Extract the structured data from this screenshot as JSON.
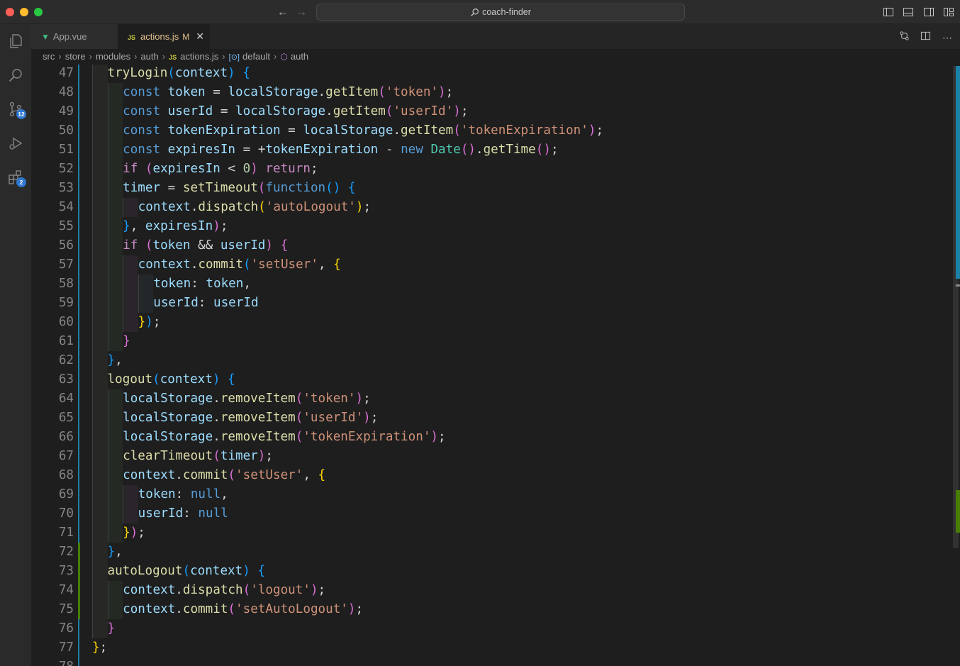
{
  "window": {
    "title": "coach-finder"
  },
  "activity": {
    "items": [
      {
        "name": "explorer-icon"
      },
      {
        "name": "search-icon"
      },
      {
        "name": "source-control-icon",
        "badge": "12"
      },
      {
        "name": "run-debug-icon"
      },
      {
        "name": "extensions-icon",
        "badge": "2"
      }
    ]
  },
  "tabs": [
    {
      "label": "App.vue",
      "icon": "vue-icon",
      "active": false
    },
    {
      "label": "actions.js",
      "icon": "js-icon",
      "active": true,
      "modified": "M"
    }
  ],
  "breadcrumb": [
    "src",
    "store",
    "modules",
    "auth",
    "actions.js",
    "default",
    "auth"
  ],
  "editor": {
    "language": "javascript",
    "lines": [
      {
        "n": "47",
        "indent": 1,
        "tokens": [
          [
            "fn",
            "tryLogin"
          ],
          [
            "p3",
            "("
          ],
          [
            "var",
            "context"
          ],
          [
            "p3",
            ")"
          ],
          [
            "op",
            " "
          ],
          [
            "p3",
            "{"
          ]
        ]
      },
      {
        "n": "48",
        "indent": 2,
        "tokens": [
          [
            "kw",
            "const"
          ],
          [
            "op",
            " "
          ],
          [
            "var",
            "token"
          ],
          [
            "op",
            " = "
          ],
          [
            "var",
            "localStorage"
          ],
          [
            "op",
            "."
          ],
          [
            "fn",
            "getItem"
          ],
          [
            "p2",
            "("
          ],
          [
            "str",
            "'token'"
          ],
          [
            "p2",
            ")"
          ],
          [
            "op",
            ";"
          ]
        ]
      },
      {
        "n": "49",
        "indent": 2,
        "tokens": [
          [
            "kw",
            "const"
          ],
          [
            "op",
            " "
          ],
          [
            "var",
            "userId"
          ],
          [
            "op",
            " = "
          ],
          [
            "var",
            "localStorage"
          ],
          [
            "op",
            "."
          ],
          [
            "fn",
            "getItem"
          ],
          [
            "p2",
            "("
          ],
          [
            "str",
            "'userId'"
          ],
          [
            "p2",
            ")"
          ],
          [
            "op",
            ";"
          ]
        ]
      },
      {
        "n": "50",
        "indent": 2,
        "tokens": [
          [
            "kw",
            "const"
          ],
          [
            "op",
            " "
          ],
          [
            "var",
            "tokenExpiration"
          ],
          [
            "op",
            " = "
          ],
          [
            "var",
            "localStorage"
          ],
          [
            "op",
            "."
          ],
          [
            "fn",
            "getItem"
          ],
          [
            "p2",
            "("
          ],
          [
            "str",
            "'tokenExpiration'"
          ],
          [
            "p2",
            ")"
          ],
          [
            "op",
            ";"
          ]
        ]
      },
      {
        "n": "51",
        "indent": 2,
        "tokens": [
          [
            "kw",
            "const"
          ],
          [
            "op",
            " "
          ],
          [
            "var",
            "expiresIn"
          ],
          [
            "op",
            " = +"
          ],
          [
            "var",
            "tokenExpiration"
          ],
          [
            "op",
            " - "
          ],
          [
            "kw",
            "new"
          ],
          [
            "op",
            " "
          ],
          [
            "cls",
            "Date"
          ],
          [
            "p2",
            "()"
          ],
          [
            "op",
            "."
          ],
          [
            "fn",
            "getTime"
          ],
          [
            "p2",
            "()"
          ],
          [
            "op",
            ";"
          ]
        ]
      },
      {
        "n": "52",
        "indent": 2,
        "tokens": [
          [
            "ctl",
            "if"
          ],
          [
            "op",
            " "
          ],
          [
            "p2",
            "("
          ],
          [
            "var",
            "expiresIn"
          ],
          [
            "op",
            " < "
          ],
          [
            "num",
            "0"
          ],
          [
            "p2",
            ")"
          ],
          [
            "op",
            " "
          ],
          [
            "ctl",
            "return"
          ],
          [
            "op",
            ";"
          ]
        ]
      },
      {
        "n": "53",
        "indent": 2,
        "tokens": [
          [
            "var",
            "timer"
          ],
          [
            "op",
            " = "
          ],
          [
            "fn",
            "setTimeout"
          ],
          [
            "p2",
            "("
          ],
          [
            "kw",
            "function"
          ],
          [
            "p3",
            "()"
          ],
          [
            "op",
            " "
          ],
          [
            "p3",
            "{"
          ]
        ]
      },
      {
        "n": "54",
        "indent": 3,
        "tokens": [
          [
            "var",
            "context"
          ],
          [
            "op",
            "."
          ],
          [
            "fn",
            "dispatch"
          ],
          [
            "p1",
            "("
          ],
          [
            "str",
            "'autoLogout'"
          ],
          [
            "p1",
            ")"
          ],
          [
            "op",
            ";"
          ]
        ]
      },
      {
        "n": "55",
        "indent": 2,
        "tokens": [
          [
            "p3",
            "}"
          ],
          [
            "op",
            ", "
          ],
          [
            "var",
            "expiresIn"
          ],
          [
            "p2",
            ")"
          ],
          [
            "op",
            ";"
          ]
        ]
      },
      {
        "n": "56",
        "indent": 2,
        "tokens": [
          [
            "ctl",
            "if"
          ],
          [
            "op",
            " "
          ],
          [
            "p2",
            "("
          ],
          [
            "var",
            "token"
          ],
          [
            "op",
            " && "
          ],
          [
            "var",
            "userId"
          ],
          [
            "p2",
            ")"
          ],
          [
            "op",
            " "
          ],
          [
            "p2",
            "{"
          ]
        ]
      },
      {
        "n": "57",
        "indent": 3,
        "tokens": [
          [
            "var",
            "context"
          ],
          [
            "op",
            "."
          ],
          [
            "fn",
            "commit"
          ],
          [
            "p3",
            "("
          ],
          [
            "str",
            "'setUser'"
          ],
          [
            "op",
            ", "
          ],
          [
            "p1",
            "{"
          ]
        ]
      },
      {
        "n": "58",
        "indent": 4,
        "tokens": [
          [
            "var",
            "token"
          ],
          [
            "op",
            ": "
          ],
          [
            "var",
            "token"
          ],
          [
            "op",
            ","
          ]
        ]
      },
      {
        "n": "59",
        "indent": 4,
        "tokens": [
          [
            "var",
            "userId"
          ],
          [
            "op",
            ": "
          ],
          [
            "var",
            "userId"
          ]
        ]
      },
      {
        "n": "60",
        "indent": 3,
        "tokens": [
          [
            "p1",
            "}"
          ],
          [
            "p3",
            ")"
          ],
          [
            "op",
            ";"
          ]
        ]
      },
      {
        "n": "61",
        "indent": 2,
        "tokens": [
          [
            "p2",
            "}"
          ]
        ]
      },
      {
        "n": "62",
        "indent": 1,
        "tokens": [
          [
            "p3",
            "}"
          ],
          [
            "op",
            ","
          ]
        ]
      },
      {
        "n": "63",
        "indent": 1,
        "tokens": [
          [
            "fn",
            "logout"
          ],
          [
            "p3",
            "("
          ],
          [
            "var",
            "context"
          ],
          [
            "p3",
            ")"
          ],
          [
            "op",
            " "
          ],
          [
            "p3",
            "{"
          ]
        ]
      },
      {
        "n": "64",
        "indent": 2,
        "tokens": [
          [
            "var",
            "localStorage"
          ],
          [
            "op",
            "."
          ],
          [
            "fn",
            "removeItem"
          ],
          [
            "p2",
            "("
          ],
          [
            "str",
            "'token'"
          ],
          [
            "p2",
            ")"
          ],
          [
            "op",
            ";"
          ]
        ]
      },
      {
        "n": "65",
        "indent": 2,
        "tokens": [
          [
            "var",
            "localStorage"
          ],
          [
            "op",
            "."
          ],
          [
            "fn",
            "removeItem"
          ],
          [
            "p2",
            "("
          ],
          [
            "str",
            "'userId'"
          ],
          [
            "p2",
            ")"
          ],
          [
            "op",
            ";"
          ]
        ]
      },
      {
        "n": "66",
        "indent": 2,
        "tokens": [
          [
            "var",
            "localStorage"
          ],
          [
            "op",
            "."
          ],
          [
            "fn",
            "removeItem"
          ],
          [
            "p2",
            "("
          ],
          [
            "str",
            "'tokenExpiration'"
          ],
          [
            "p2",
            ")"
          ],
          [
            "op",
            ";"
          ]
        ]
      },
      {
        "n": "67",
        "indent": 2,
        "tokens": [
          [
            "fn",
            "clearTimeout"
          ],
          [
            "p2",
            "("
          ],
          [
            "var",
            "timer"
          ],
          [
            "p2",
            ")"
          ],
          [
            "op",
            ";"
          ]
        ]
      },
      {
        "n": "68",
        "indent": 2,
        "tokens": [
          [
            "var",
            "context"
          ],
          [
            "op",
            "."
          ],
          [
            "fn",
            "commit"
          ],
          [
            "p2",
            "("
          ],
          [
            "str",
            "'setUser'"
          ],
          [
            "op",
            ", "
          ],
          [
            "p1",
            "{"
          ]
        ]
      },
      {
        "n": "69",
        "indent": 3,
        "tokens": [
          [
            "var",
            "token"
          ],
          [
            "op",
            ": "
          ],
          [
            "kw",
            "null"
          ],
          [
            "op",
            ","
          ]
        ]
      },
      {
        "n": "70",
        "indent": 3,
        "tokens": [
          [
            "var",
            "userId"
          ],
          [
            "op",
            ": "
          ],
          [
            "kw",
            "null"
          ]
        ]
      },
      {
        "n": "71",
        "indent": 2,
        "tokens": [
          [
            "p1",
            "}"
          ],
          [
            "p2",
            ")"
          ],
          [
            "op",
            ";"
          ]
        ]
      },
      {
        "n": "72",
        "indent": 1,
        "tokens": [
          [
            "p3",
            "}"
          ],
          [
            "op",
            ","
          ]
        ]
      },
      {
        "n": "73",
        "indent": 1,
        "tokens": [
          [
            "fn",
            "autoLogout"
          ],
          [
            "p3",
            "("
          ],
          [
            "var",
            "context"
          ],
          [
            "p3",
            ")"
          ],
          [
            "op",
            " "
          ],
          [
            "p3",
            "{"
          ]
        ]
      },
      {
        "n": "74",
        "indent": 2,
        "tokens": [
          [
            "var",
            "context"
          ],
          [
            "op",
            "."
          ],
          [
            "fn",
            "dispatch"
          ],
          [
            "p2",
            "("
          ],
          [
            "str",
            "'logout'"
          ],
          [
            "p2",
            ")"
          ],
          [
            "op",
            ";"
          ]
        ]
      },
      {
        "n": "75",
        "indent": 2,
        "tokens": [
          [
            "var",
            "context"
          ],
          [
            "op",
            "."
          ],
          [
            "fn",
            "commit"
          ],
          [
            "p2",
            "("
          ],
          [
            "str",
            "'setAutoLogout'"
          ],
          [
            "p2",
            ")"
          ],
          [
            "op",
            ";"
          ]
        ]
      },
      {
        "n": "76",
        "indent": 1,
        "tokens": [
          [
            "p2",
            "}"
          ]
        ]
      },
      {
        "n": "77",
        "indent": 0,
        "tokens": [
          [
            "p1",
            "}"
          ],
          [
            "op",
            ";"
          ]
        ]
      },
      {
        "n": "78",
        "indent": 0,
        "tokens": []
      }
    ]
  },
  "colors": {
    "modified_gutter": "#1b81a8",
    "added_gutter": "#487e02",
    "tab_modified": "#e2c08d"
  }
}
